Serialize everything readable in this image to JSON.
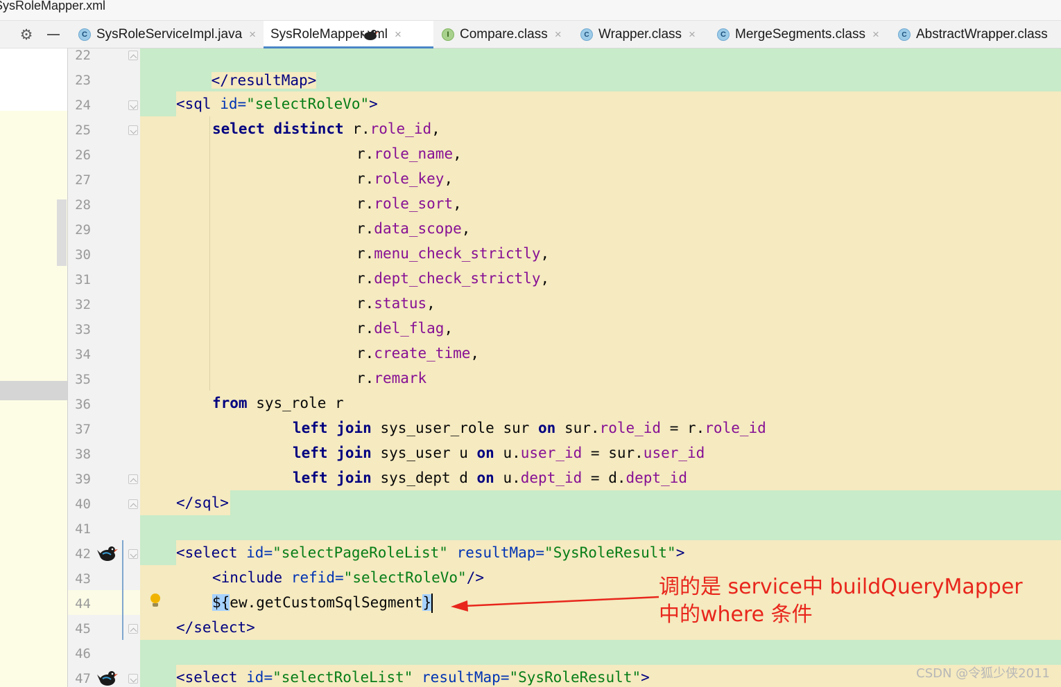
{
  "window": {
    "title": "SysRoleMapper.xml"
  },
  "tabs": [
    {
      "label": "SysRoleServiceImpl.java",
      "icon": "class-icon",
      "badge": "C",
      "active": false,
      "closable": true
    },
    {
      "label": "SysRoleMapper.xml",
      "icon": "mybatis-bird-icon",
      "badge": "",
      "active": true,
      "closable": true
    },
    {
      "label": "Compare.class",
      "icon": "interface-icon",
      "badge": "I",
      "active": false,
      "closable": true
    },
    {
      "label": "Wrapper.class",
      "icon": "abstract-class-icon",
      "badge": "C",
      "active": false,
      "closable": true
    },
    {
      "label": "MergeSegments.class",
      "icon": "class-icon",
      "badge": "C",
      "active": false,
      "closable": true
    },
    {
      "label": "AbstractWrapper.class",
      "icon": "abstract-class-icon",
      "badge": "C",
      "active": false,
      "closable": false
    }
  ],
  "close_glyph": "×",
  "gutter": {
    "line_numbers": [
      "22",
      "23",
      "24",
      "25",
      "26",
      "27",
      "28",
      "29",
      "30",
      "31",
      "32",
      "33",
      "34",
      "35",
      "36",
      "37",
      "38",
      "39",
      "40",
      "41",
      "42",
      "43",
      "44",
      "45",
      "46",
      "47"
    ]
  },
  "code": {
    "l22": [
      "</resultMap>"
    ],
    "l24": [
      "<sql",
      " id=",
      "\"selectRoleVo\"",
      ">"
    ],
    "l25": [
      "select",
      " ",
      "distinct",
      " r.",
      "role_id",
      ","
    ],
    "l26": [
      "r.",
      "role_name",
      ","
    ],
    "l27": [
      "r.",
      "role_key",
      ","
    ],
    "l28": [
      "r.",
      "role_sort",
      ","
    ],
    "l29": [
      "r.",
      "data_scope",
      ","
    ],
    "l30": [
      "r.",
      "menu_check_strictly",
      ","
    ],
    "l31": [
      "r.",
      "dept_check_strictly",
      ","
    ],
    "l32": [
      "r.",
      "status",
      ","
    ],
    "l33": [
      "r.",
      "del_flag",
      ","
    ],
    "l34": [
      "r.",
      "create_time",
      ","
    ],
    "l35": [
      "r.",
      "remark"
    ],
    "l36": [
      "from",
      " sys_role r"
    ],
    "l37": [
      "left",
      " ",
      "join",
      " sys_user_role sur ",
      "on",
      " sur.",
      "role_id",
      " = r.",
      "role_id"
    ],
    "l38": [
      "left",
      " ",
      "join",
      " sys_user u ",
      "on",
      " u.",
      "user_id",
      " = sur.",
      "user_id"
    ],
    "l39": [
      "left",
      " ",
      "join",
      " sys_dept d ",
      "on",
      " u.",
      "dept_id",
      " = d.",
      "dept_id"
    ],
    "l40": [
      "</sql>"
    ],
    "l42": [
      "<select",
      " id=",
      "\"selectPageRoleList\"",
      " resultMap=",
      "\"SysRoleResult\"",
      ">"
    ],
    "l43": [
      "<include",
      " refid=",
      "\"selectRoleVo\"",
      "/>"
    ],
    "l44": [
      "${",
      "ew.getCustomSqlSegment",
      "}"
    ],
    "l45": [
      "</select>"
    ],
    "l47": [
      "<select",
      " id=",
      "\"selectRoleList\"",
      " resultMap=",
      "\"SysRoleResult\"",
      ">"
    ]
  },
  "annotation": {
    "line1": "调的是 service中 buildQueryMapper",
    "line2": "中的where 条件",
    "color": "#e8261c"
  },
  "watermark": "CSDN @令狐少侠2011",
  "colors": {
    "tag": "#000080",
    "attribute": "#0033b3",
    "string": "#067d17",
    "keyword": "#000080",
    "field": "#871094",
    "diff_green": "#c8ebc9",
    "diff_yellow": "#f5eac0",
    "active_tab_underline": "#4a86c7"
  }
}
